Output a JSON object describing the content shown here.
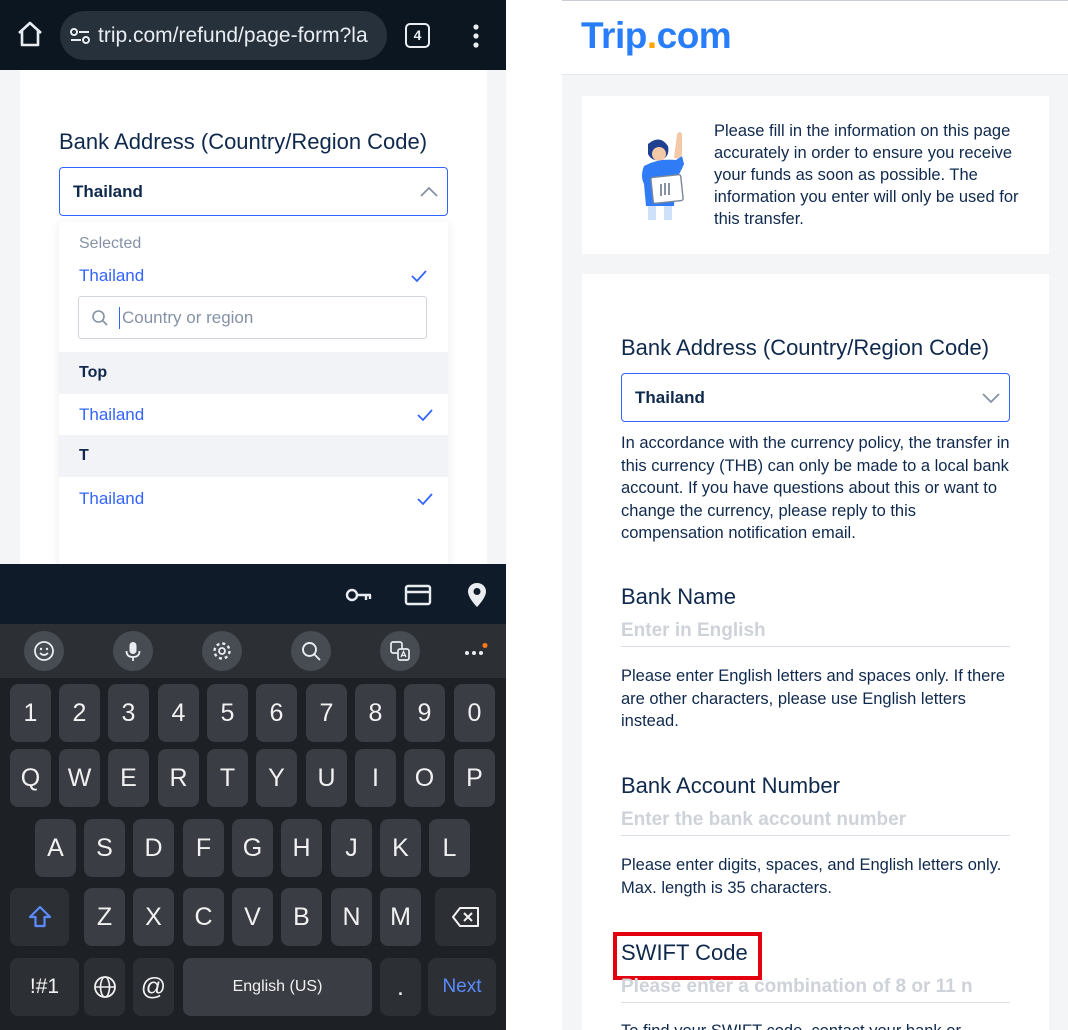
{
  "left": {
    "browser": {
      "url": "trip.com/refund/page-form?la",
      "tab_count": "4"
    },
    "form": {
      "field_label": "Bank Address (Country/Region Code)",
      "selected_value": "Thailand"
    },
    "dropdown": {
      "selected_heading": "Selected",
      "selected_item": "Thailand",
      "search_placeholder": "Country or region",
      "groups": [
        {
          "title": "Top",
          "item": "Thailand"
        },
        {
          "title": "T",
          "item": "Thailand"
        }
      ]
    },
    "keyboard": {
      "row_numbers": [
        "1",
        "2",
        "3",
        "4",
        "5",
        "6",
        "7",
        "8",
        "9",
        "0"
      ],
      "row1": [
        "Q",
        "W",
        "E",
        "R",
        "T",
        "Y",
        "U",
        "I",
        "O",
        "P"
      ],
      "row2": [
        "A",
        "S",
        "D",
        "F",
        "G",
        "H",
        "J",
        "K",
        "L"
      ],
      "row3": [
        "Z",
        "X",
        "C",
        "V",
        "B",
        "N",
        "M"
      ],
      "symbols_key": "!#1",
      "at_key": "@",
      "space_label": "English (US)",
      "period_key": ".",
      "next_key": "Next"
    }
  },
  "right": {
    "logo": {
      "part1": "Trip",
      "dot": ".",
      "part2": "com"
    },
    "info_text": "Please fill in the information on this page accurately in order to ensure you receive your funds as soon as possible. The information you enter will only be used for this transfer.",
    "bank_address": {
      "label": "Bank Address (Country/Region Code)",
      "value": "Thailand",
      "note": "In accordance with the currency policy, the transfer in this currency (THB) can only be made to a local bank account. If you have questions about this or want to change the currency, please reply to this compensation notification email."
    },
    "bank_name": {
      "label": "Bank Name",
      "placeholder": "Enter in English",
      "note": "Please enter English letters and spaces only. If there are other characters, please use English letters instead."
    },
    "bank_account": {
      "label": "Bank Account Number",
      "placeholder": "Enter the bank account number",
      "note": "Please enter digits, spaces, and English letters only. Max. length is 35 characters."
    },
    "swift": {
      "label": "SWIFT Code",
      "placeholder": "Please enter a combination of 8 or 11 n",
      "note": "To find your SWIFT code, contact your bank or"
    }
  },
  "colors": {
    "accent_blue": "#3264ff",
    "text_navy": "#0f294d",
    "logo_blue": "#287dfa",
    "logo_orange": "#ffa50a",
    "highlight_red": "#e3000f"
  }
}
